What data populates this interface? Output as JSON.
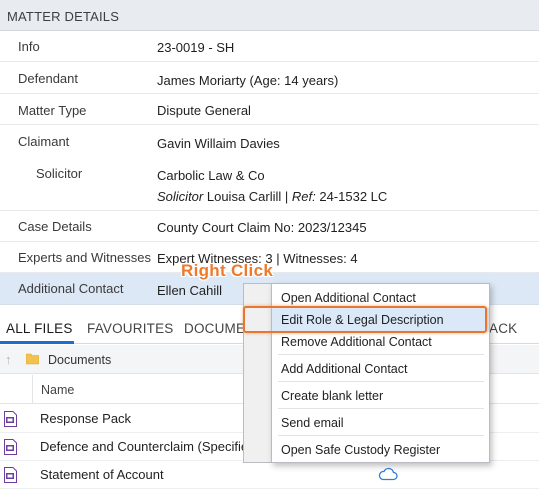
{
  "header": {
    "title": "MATTER DETAILS"
  },
  "details": [
    {
      "label": "Info",
      "value": "23-0019 - SH"
    },
    {
      "label": "Defendant",
      "value": "James Moriarty (Age: 14 years)"
    },
    {
      "label": "Matter Type",
      "value": "Dispute General"
    },
    {
      "label": "Claimant",
      "value": "Gavin Willaim Davies"
    },
    {
      "label": "Solicitor",
      "firm": "Carbolic Law & Co",
      "role": "Solicitor",
      "name": " Louisa Carlill | ",
      "ref_label": "Ref:",
      "ref": " 24-1532 LC"
    },
    {
      "label": "Case Details",
      "value": "County Court Claim No: 2023/12345"
    },
    {
      "label": "Experts and Witnesses",
      "value": "Expert Witnesses: 3 | Witnesses: 4"
    },
    {
      "label": "Additional Contact",
      "value": "Ellen Cahill"
    }
  ],
  "tabs": {
    "all_files": "ALL FILES",
    "favourites": "FAVOURITES",
    "documents": "DOCUME",
    "partial_right": "ACK"
  },
  "breadcrumb": {
    "folder": "Documents"
  },
  "table": {
    "name_header": "Name"
  },
  "files": [
    {
      "name": "Response Pack"
    },
    {
      "name": "Defence and Counterclaim (Specifie"
    },
    {
      "name": "Statement of Account"
    }
  ],
  "context_menu": {
    "items": [
      "Open Additional Contact",
      "Edit Role & Legal Description",
      "Remove Additional Contact",
      "Add Additional Contact",
      "Create blank letter",
      "Send email",
      "Open Safe Custody Register"
    ],
    "highlighted_index": 1
  },
  "annotation": {
    "text": "Right Click",
    "color": "#ee7a2b"
  },
  "colors": {
    "accent": "#1c6dd0",
    "selection": "#dce8f5",
    "highlight_border": "#e8762c"
  }
}
